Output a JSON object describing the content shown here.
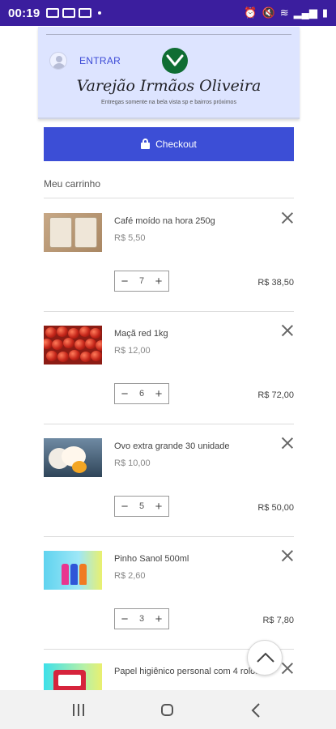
{
  "status_bar": {
    "time": "00:19"
  },
  "header": {
    "login_label": "ENTRAR",
    "store_name": "Varejão Irmãos Oliveira",
    "store_subtitle": "Entregas somente na bela vista sp e bairros próximos",
    "logo_color": "#0f6d33",
    "background_color": "#dde4ff"
  },
  "checkout": {
    "label": "Checkout",
    "icon": "lock-icon",
    "color": "#3c4ed6"
  },
  "cart": {
    "title": "Meu carrinho",
    "items": [
      {
        "name": "Café moído na hora 250g",
        "price": "R$ 5,50",
        "quantity": "7",
        "total": "R$ 38,50"
      },
      {
        "name": "Maçã red 1kg",
        "price": "R$ 12,00",
        "quantity": "6",
        "total": "R$ 72,00"
      },
      {
        "name": "Ovo extra grande 30 unidade",
        "price": "R$ 10,00",
        "quantity": "5",
        "total": "R$ 50,00"
      },
      {
        "name": "Pinho Sanol 500ml",
        "price": "R$ 2,60",
        "quantity": "3",
        "total": "R$ 7,80"
      },
      {
        "name": "Papel higiênico personal com 4 rolos",
        "price": "",
        "quantity": "",
        "total": ""
      }
    ],
    "stepper": {
      "minus": "−",
      "plus": "+"
    }
  },
  "icons": {
    "remove": "close-icon",
    "scroll_up": "chevron-up-icon",
    "nav": [
      "recents-icon",
      "home-icon",
      "back-icon"
    ]
  }
}
